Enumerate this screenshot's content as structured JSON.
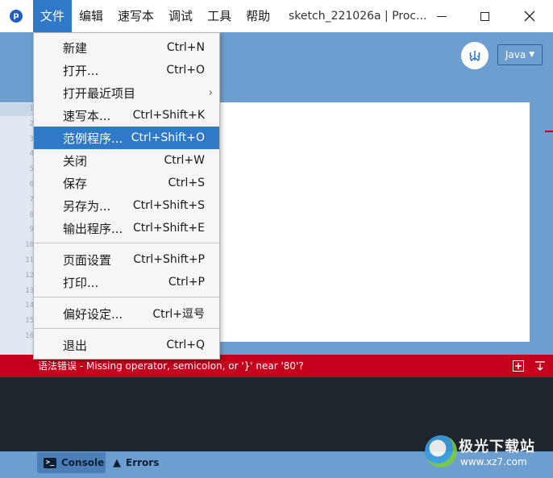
{
  "titlebar": {
    "menus": [
      "文件",
      "编辑",
      "速写本",
      "调试",
      "工具",
      "帮助"
    ],
    "window_title": "sketch_221026a | Proc..."
  },
  "toolbar": {
    "debug_icon": "butterfly-icon",
    "mode": "Java",
    "mode_caret": "▼"
  },
  "editor": {
    "line_numbers": [
      "1",
      "2",
      "3",
      "4",
      "5",
      "6",
      "7",
      "8",
      "9",
      "10",
      "11",
      "12",
      "13",
      "14",
      "15",
      "16"
    ]
  },
  "file_menu": {
    "items": [
      {
        "label": "新建",
        "shortcut": "Ctrl+N"
      },
      {
        "label": "打开...",
        "shortcut": "Ctrl+O"
      },
      {
        "label": "打开最近项目",
        "shortcut": ""
      },
      {
        "label": "速写本...",
        "shortcut": "Ctrl+Shift+K"
      },
      {
        "label": "范例程序...",
        "shortcut": "Ctrl+Shift+O"
      },
      {
        "label": "关闭",
        "shortcut": "Ctrl+W"
      },
      {
        "label": "保存",
        "shortcut": "Ctrl+S"
      },
      {
        "label": "另存为...",
        "shortcut": "Ctrl+Shift+S"
      },
      {
        "label": "输出程序...",
        "shortcut": "Ctrl+Shift+E"
      },
      {
        "label": "页面设置",
        "shortcut": "Ctrl+Shift+P"
      },
      {
        "label": "打印...",
        "shortcut": "Ctrl+P"
      },
      {
        "label": "偏好设定...",
        "shortcut": "Ctrl+逗号"
      },
      {
        "label": "退出",
        "shortcut": "Ctrl+Q"
      }
    ],
    "submenu_arrow": "›",
    "highlighted_index": 4
  },
  "error_bar": {
    "message": "语法错误 - Missing operator, semicolon, or '}' near '80'?"
  },
  "footer": {
    "console_tab": "Console",
    "errors_tab": "Errors",
    "console_icon_glyph": ">_",
    "warning_icon_glyph": "▲"
  },
  "watermark": {
    "title": "极光下载站",
    "url": "www.xz7.com"
  },
  "colors": {
    "accent": "#2f79c8",
    "toolbar": "#6c9ed0",
    "error": "#c4001c",
    "console": "#1f252c"
  }
}
